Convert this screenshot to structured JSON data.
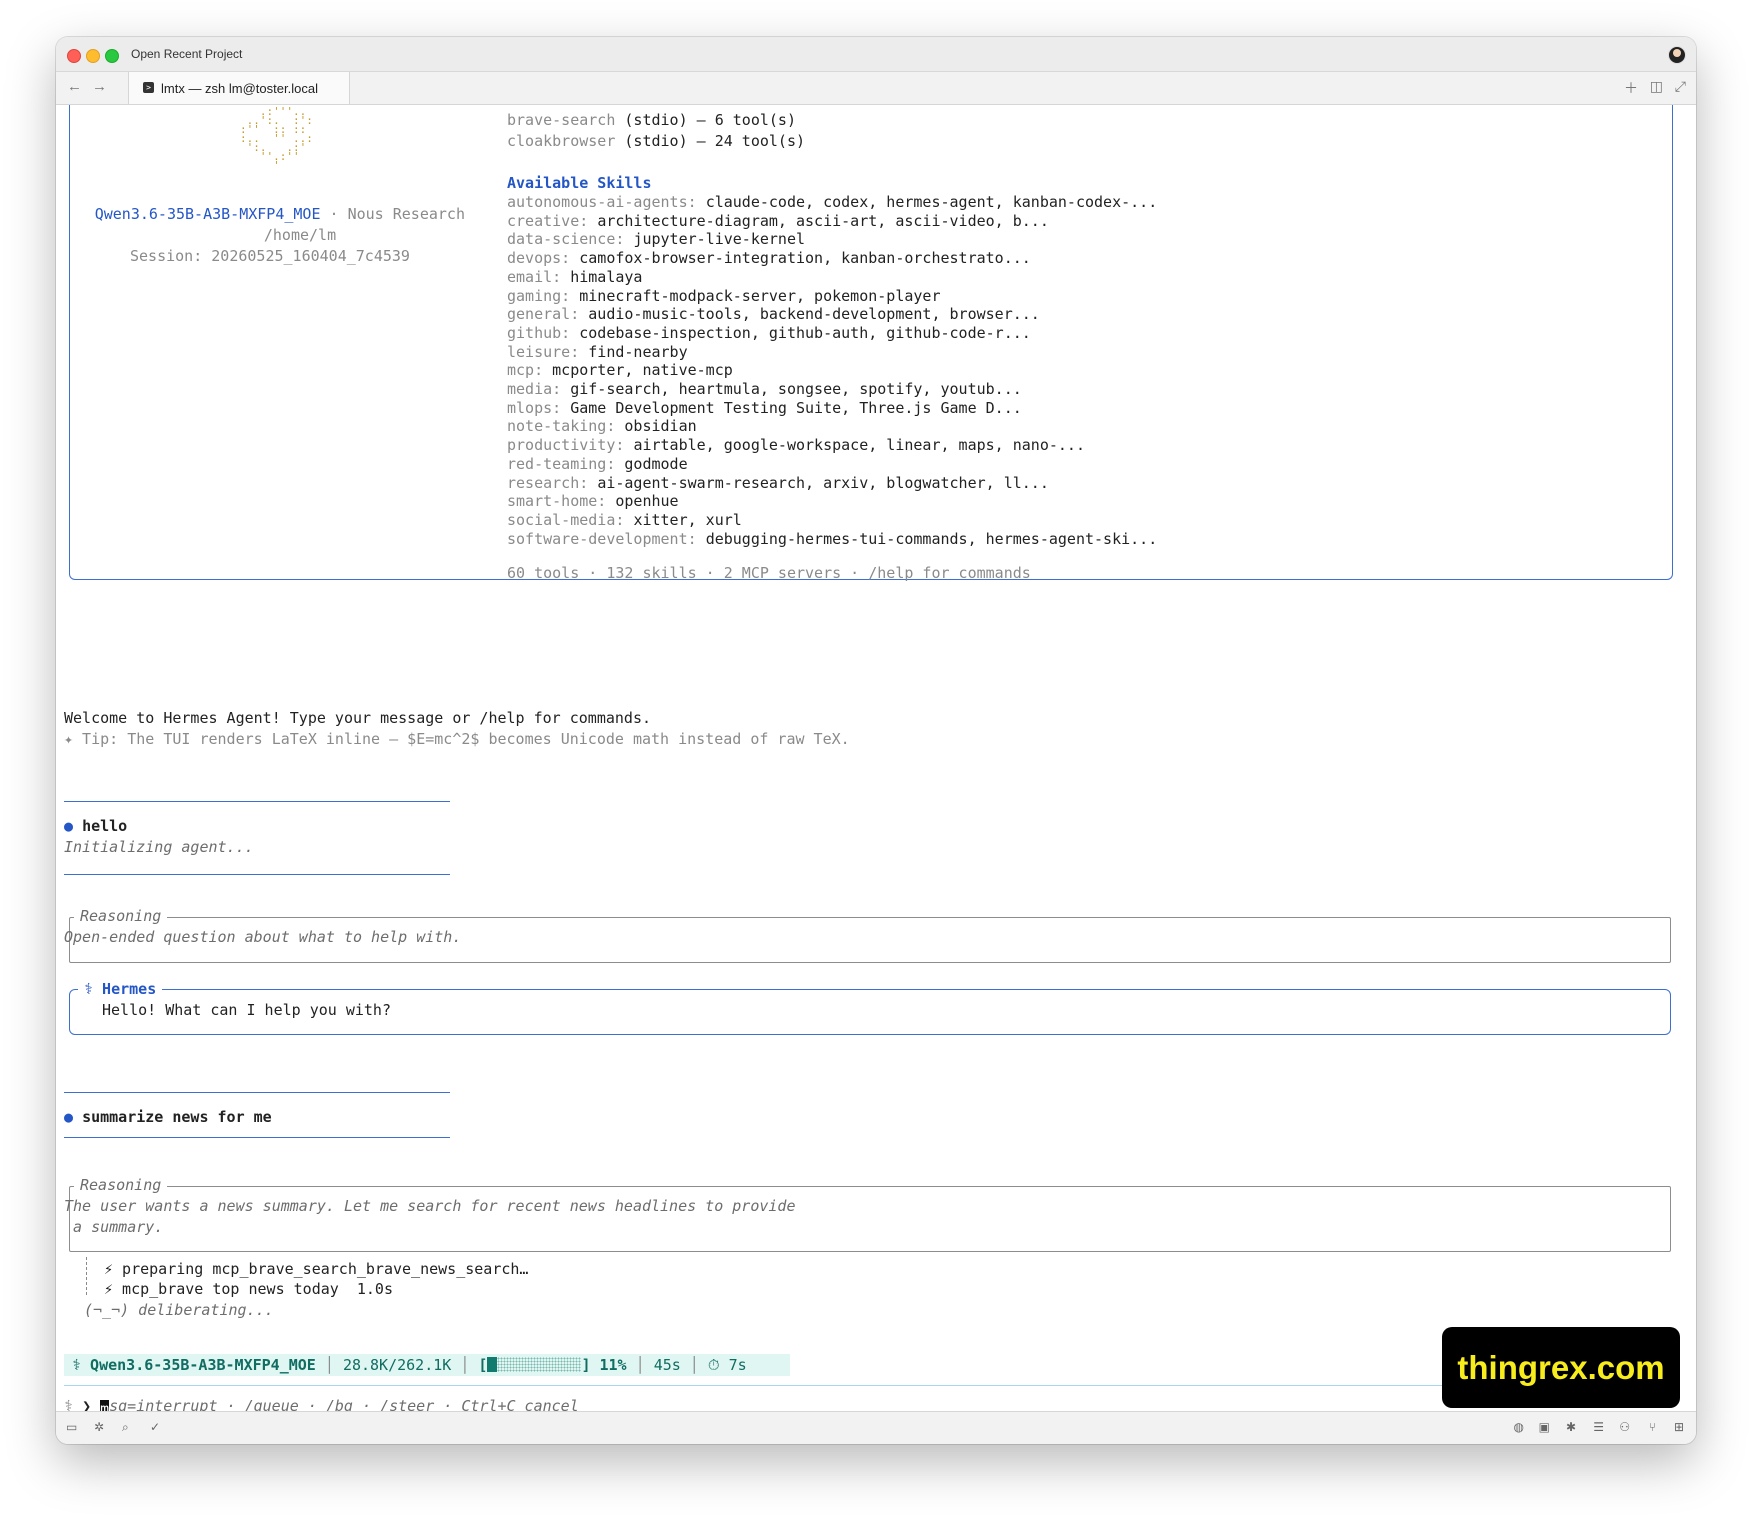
{
  "window": {
    "title": "Open Recent Project",
    "tab_label": "lmtx — zsh lm@toster.local"
  },
  "banner": {
    "model": "Qwen3.6-35B-A3B-MXFP4_MOE",
    "provider": "· Nous Research",
    "cwd": "/home/lm",
    "session": "Session: 20260525_160404_7c4539",
    "mcp_servers": [
      {
        "name": "brave-search",
        "detail": "(stdio) — 6 tool(s)"
      },
      {
        "name": "cloakbrowser",
        "detail": "(stdio) — 24 tool(s)"
      }
    ],
    "skills_heading": "Available Skills",
    "skills": [
      {
        "cat": "autonomous-ai-agents:",
        "items": "claude-code, codex, hermes-agent, kanban-codex-..."
      },
      {
        "cat": "creative:",
        "items": "architecture-diagram, ascii-art, ascii-video, b..."
      },
      {
        "cat": "data-science:",
        "items": "jupyter-live-kernel"
      },
      {
        "cat": "devops:",
        "items": "camofox-browser-integration, kanban-orchestrato..."
      },
      {
        "cat": "email:",
        "items": "himalaya"
      },
      {
        "cat": "gaming:",
        "items": "minecraft-modpack-server, pokemon-player"
      },
      {
        "cat": "general:",
        "items": "audio-music-tools, backend-development, browser..."
      },
      {
        "cat": "github:",
        "items": "codebase-inspection, github-auth, github-code-r..."
      },
      {
        "cat": "leisure:",
        "items": "find-nearby"
      },
      {
        "cat": "mcp:",
        "items": "mcporter, native-mcp"
      },
      {
        "cat": "media:",
        "items": "gif-search, heartmula, songsee, spotify, youtub..."
      },
      {
        "cat": "mlops:",
        "items": "Game Development Testing Suite, Three.js Game D..."
      },
      {
        "cat": "note-taking:",
        "items": "obsidian"
      },
      {
        "cat": "productivity:",
        "items": "airtable, google-workspace, linear, maps, nano-..."
      },
      {
        "cat": "red-teaming:",
        "items": "godmode"
      },
      {
        "cat": "research:",
        "items": "ai-agent-swarm-research, arxiv, blogwatcher, ll..."
      },
      {
        "cat": "smart-home:",
        "items": "openhue"
      },
      {
        "cat": "social-media:",
        "items": "xitter, xurl"
      },
      {
        "cat": "software-development:",
        "items": "debugging-hermes-tui-commands, hermes-agent-ski..."
      }
    ],
    "summary": "60 tools · 132 skills · 2 MCP servers · /help for commands"
  },
  "welcome": "Welcome to Hermes Agent! Type your message or /help for commands.",
  "tip": "✦ Tip: The TUI renders LaTeX inline — $E=mc^2$ becomes Unicode math instead of raw TeX.",
  "conversation": {
    "user1": "hello",
    "init": "Initializing agent...",
    "reasoning_label": "Reasoning",
    "reasoning1": "Open-ended question about what to help with.",
    "hermes_label": "⚕ Hermes",
    "hermes_reply": "Hello! What can I help you with?",
    "user2": "summarize news for me",
    "reasoning2_line1": "The user wants a news summary. Let me search for recent news headlines to provide",
    "reasoning2_line2": " a summary.",
    "tool1": "⚡ preparing mcp_brave_search_brave_news_search…",
    "tool2": "⚡ mcp_brave top news today  1.0s",
    "thinking": "(¬_¬) deliberating..."
  },
  "status": {
    "model": "⚕ Qwen3.6-35B-A3B-MXFP4_MOE",
    "tokens": "28.8K/262.1K",
    "context_percent": "11%",
    "context_fraction": 0.11,
    "elapsed": "45s",
    "timer": "⏱ 7s"
  },
  "input": {
    "prompt": "❯",
    "cursor_char": "m",
    "hint": "sg=interrupt · /queue · /bg · /steer · Ctrl+C cancel"
  },
  "watermark": "thingrex.com"
}
